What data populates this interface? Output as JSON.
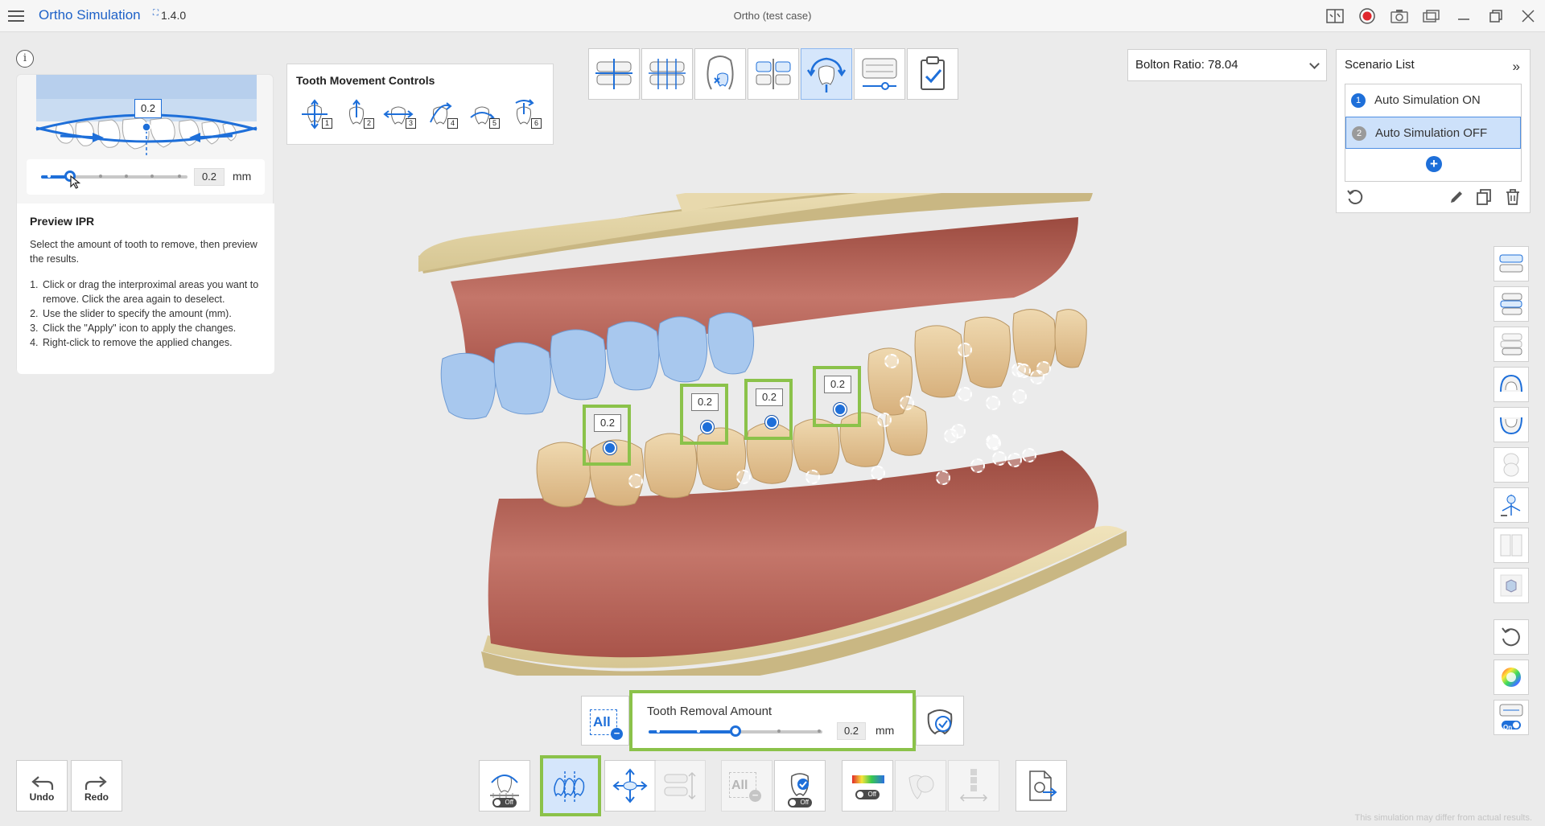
{
  "titlebar": {
    "app_name": "Ortho Simulation",
    "version": "1.4.0",
    "window_title": "Ortho (test case)"
  },
  "ipr_panel": {
    "illustration_value": "0.2",
    "slider_value": "0.2",
    "slider_level": 0.2,
    "unit": "mm",
    "title": "Preview IPR",
    "description": "Select the amount of tooth to remove, then preview the results.",
    "steps": [
      "Click or drag the interproximal areas you want to remove. Click the area again to deselect.",
      "Use the slider to specify the amount (mm).",
      "Click the \"Apply\" icon to apply the changes.",
      "Right-click to remove the applied changes."
    ]
  },
  "tooth_movement": {
    "title": "Tooth Movement Controls",
    "buttons": [
      "1",
      "2",
      "3",
      "4",
      "5",
      "6"
    ]
  },
  "top_toolbar": {
    "active_index": 4,
    "icons": [
      "occlusion-icon",
      "grid-overlay-icon",
      "tooth-exclusion-icon",
      "attachment-icon",
      "rotation-view-icon",
      "superimpose-icon",
      "checklist-icon"
    ]
  },
  "bolton": {
    "label": "Bolton Ratio: 78.04"
  },
  "scenario_list": {
    "title": "Scenario List",
    "items": [
      {
        "num": "1",
        "label": "Auto Simulation ON",
        "badge_color": "#1e6fd9",
        "selected": false
      },
      {
        "num": "2",
        "label": "Auto Simulation OFF",
        "badge_color": "#9a9a9a",
        "selected": true
      }
    ]
  },
  "ipr_markers": [
    "0.2",
    "0.2",
    "0.2",
    "0.2"
  ],
  "removal_bar": {
    "all_label": "All",
    "title": "Tooth Removal Amount",
    "value": "0.2",
    "unit": "mm",
    "level": 0.2
  },
  "undo_redo": {
    "undo": "Undo",
    "redo": "Redo"
  },
  "badges": {
    "off": "Off",
    "on": "On"
  },
  "disclaimer": "This simulation may differ from actual results.",
  "colors": {
    "accent": "#1e6fd9",
    "highlight": "#8bc24a",
    "gingiva": "#b35a4d",
    "base": "#e8d9ad"
  }
}
